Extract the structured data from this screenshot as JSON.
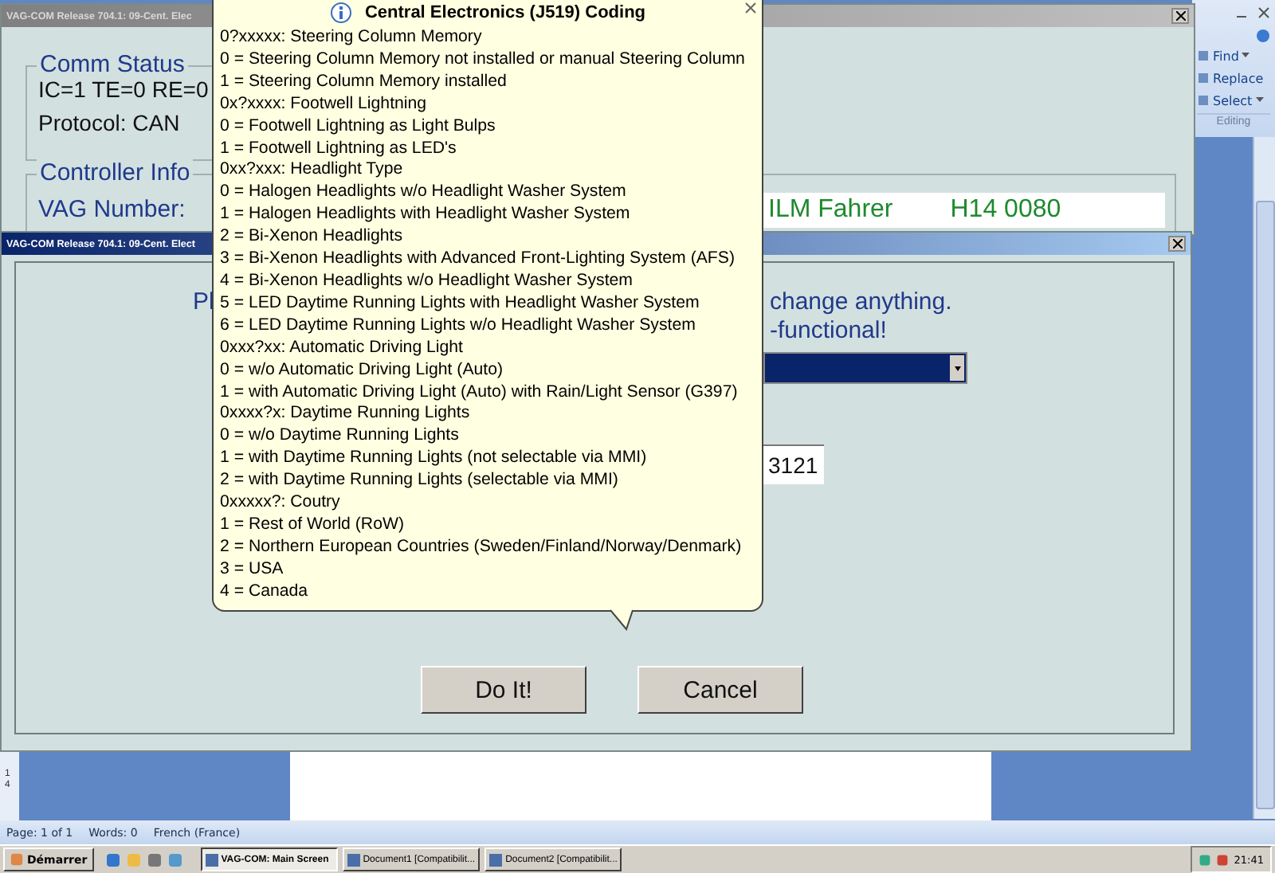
{
  "word": {
    "ribbon": {
      "items": [
        {
          "label": "Find",
          "caret": true
        },
        {
          "label": "Replace",
          "caret": false
        },
        {
          "label": "Select",
          "caret": true
        }
      ],
      "group": "Editing"
    },
    "ruler_label": "14",
    "status_bar": [
      "Page: 1 of 1",
      "Words: 0",
      "French (France)"
    ]
  },
  "main_window": {
    "title": "VAG-COM Release 704.1: 09-Cent. Elec",
    "active": false,
    "comm_status": {
      "title": "Comm Status",
      "counters": "IC=1  TE=0  RE=0",
      "protocol": "Protocol: CAN"
    },
    "controller_info": {
      "title": "Controller Info",
      "vag_number_label": "VAG Number:",
      "component": "ILM Fahrer",
      "version": "H14 0080"
    }
  },
  "dialog": {
    "title": "VAG-COM Release 704.1: 09-Cent. Elect",
    "active": true,
    "message_start": "Pl",
    "message_line_1_end": "change anything.",
    "message_line_2_end": "-functional!",
    "coding_field": {
      "value": "3121"
    },
    "buttons": [
      "Do It!",
      "Cancel"
    ]
  },
  "balloon": {
    "title": "Central Electronics (J519) Coding",
    "lines": [
      "0?xxxxx: Steering Column Memory",
      "0 = Steering Column Memory not installed or manual Steering Column",
      "1 = Steering Column Memory installed",
      "0x?xxxx: Footwell Lightning",
      "0 = Footwell Lightning as Light Bulps",
      "1 = Footwell Lightning as LED's",
      "0xx?xxx: Headlight Type",
      "0 = Halogen Headlights w/o Headlight Washer System",
      "1 = Halogen Headlights with Headlight Washer System",
      "2 = Bi-Xenon Headlights",
      "3 = Bi-Xenon Headlights with Advanced Front-Lighting System (AFS)",
      "4 = Bi-Xenon Headlights w/o Headlight Washer System",
      "5 = LED Daytime Running Lights with Headlight Washer System",
      "6 = LED Daytime Running Lights w/o Headlight Washer System",
      "0xxx?xx: Automatic Driving Light",
      "0 = w/o Automatic Driving Light (Auto)",
      "1 = with Automatic Driving Light (Auto) with Rain/Light Sensor (G397)",
      "0xxxx?x: Daytime Running Lights",
      "0 = w/o Daytime Running Lights",
      "1 = with Daytime Running Lights (not selectable via MMI)",
      "2 = with Daytime Running Lights (selectable via MMI)",
      "0xxxxx?: Coutry",
      "1 = Rest of World (RoW)",
      "2 = Northern European Countries (Sweden/Finland/Norway/Denmark)",
      "3 = USA",
      "4 = Canada"
    ]
  },
  "taskbar": {
    "start": "Démarrer",
    "tasks": [
      {
        "label": "VAG-COM: Main Screen",
        "selected": true
      },
      {
        "label": "Document1 [Compatibilit...",
        "selected": false
      },
      {
        "label": "Document2 [Compatibilit...",
        "selected": false
      }
    ],
    "clock": "21:41"
  }
}
